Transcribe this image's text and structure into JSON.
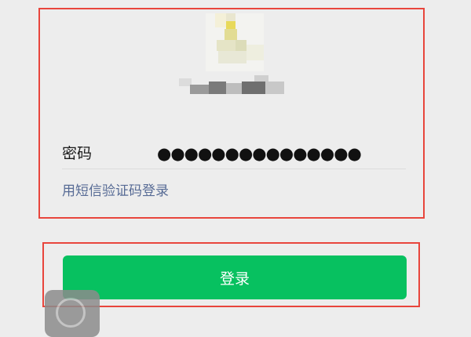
{
  "login": {
    "password_label": "密码",
    "password_value": "●●●●●●●●●●●●●●●",
    "sms_login_link": "用短信验证码登录",
    "login_button": "登录"
  },
  "colors": {
    "primary_button": "#07c160",
    "link": "#576b95",
    "annotation_border": "#e8453c",
    "background": "#ededed"
  },
  "icons": {
    "avatar": "user-avatar-blurred",
    "floating_button": "assistive-touch-icon"
  }
}
